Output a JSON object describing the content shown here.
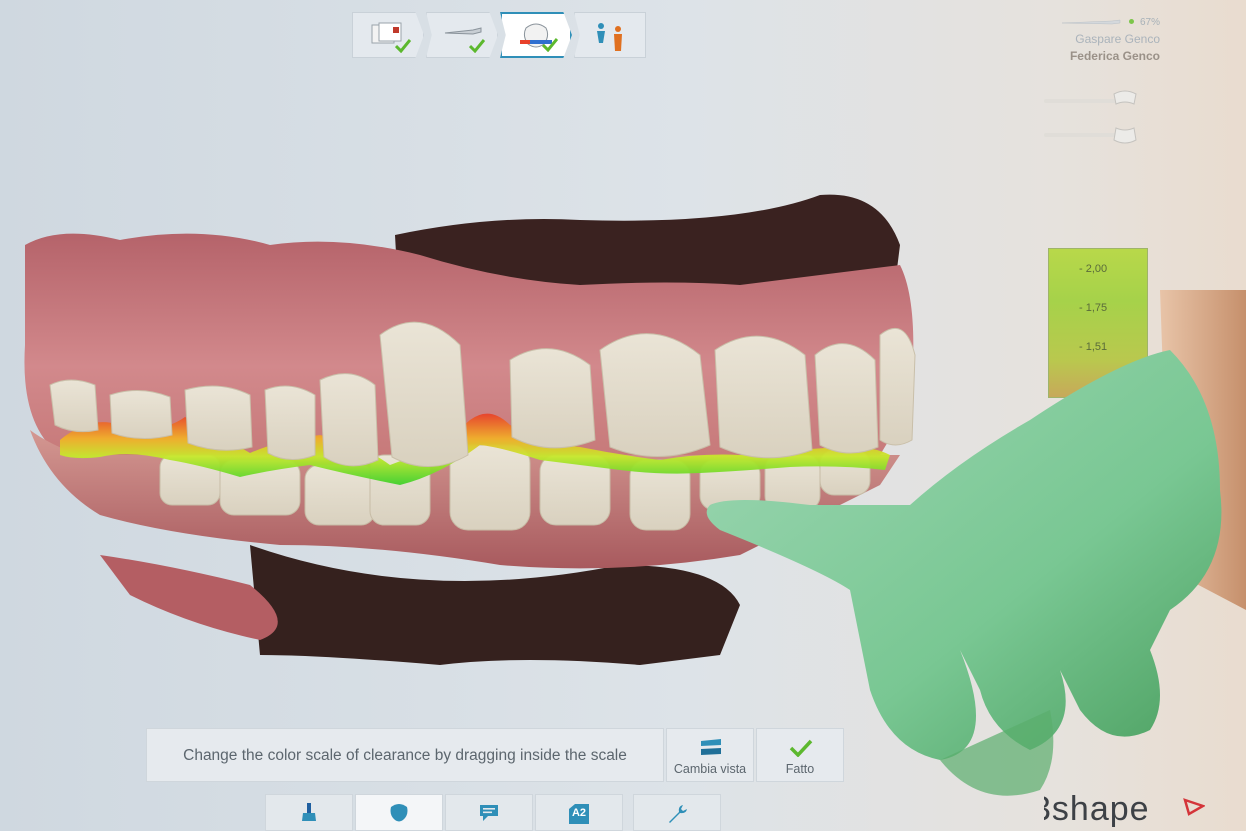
{
  "workflow": {
    "steps": [
      {
        "name": "order-form",
        "done": true
      },
      {
        "name": "scan",
        "done": true
      },
      {
        "name": "analyze",
        "done": true,
        "active": true
      },
      {
        "name": "patient-view",
        "done": false
      }
    ]
  },
  "patient": {
    "battery": "67%",
    "doctor": "Gaspare Genco",
    "patient_name": "Federica Genco"
  },
  "scale": {
    "ticks": [
      "- 2,00",
      "- 1,75",
      "- 1,51"
    ]
  },
  "instruction": {
    "text": "Change the color scale of clearance by dragging inside the scale"
  },
  "actions": {
    "change_view": "Cambia vista",
    "done": "Fatto"
  },
  "toolbar": {
    "items": [
      "paint-icon",
      "tooth-icon",
      "comment-icon",
      "shade-icon",
      "wrench-icon"
    ],
    "shade_label": "A2"
  },
  "brand": {
    "name": "3shape"
  },
  "colors": {
    "accent": "#2f8fb8",
    "check": "#5cb82e",
    "clearance_green": "#3ed12c",
    "clearance_red": "#e8412a"
  }
}
